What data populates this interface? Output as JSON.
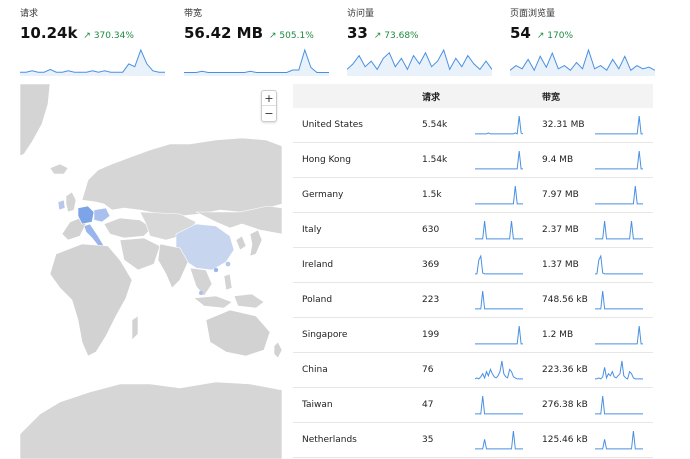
{
  "accent": "#4a90e2",
  "stats": [
    {
      "label": "请求",
      "value": "10.24k",
      "change": "↗ 370.34%",
      "spark": [
        2,
        2,
        3,
        2,
        2,
        4,
        2,
        2,
        3,
        2,
        2,
        2,
        3,
        2,
        3,
        2,
        2,
        2,
        8,
        6,
        18,
        8,
        3,
        2,
        2
      ]
    },
    {
      "label": "带宽",
      "value": "56.42 MB",
      "change": "↗ 505.1%",
      "spark": [
        2,
        2,
        2,
        3,
        2,
        2,
        2,
        2,
        2,
        2,
        2,
        3,
        2,
        2,
        2,
        2,
        2,
        2,
        4,
        4,
        20,
        6,
        2,
        2,
        2
      ]
    },
    {
      "label": "访问量",
      "value": "33",
      "change": "↗ 73.68%",
      "spark": [
        4,
        8,
        14,
        6,
        10,
        4,
        12,
        16,
        6,
        12,
        4,
        14,
        8,
        16,
        6,
        10,
        18,
        4,
        12,
        6,
        14,
        8,
        4,
        10,
        4
      ]
    },
    {
      "label": "页面浏览量",
      "value": "54",
      "change": "↗ 170%",
      "spark": [
        3,
        6,
        4,
        10,
        3,
        12,
        5,
        14,
        4,
        6,
        3,
        8,
        4,
        16,
        4,
        6,
        3,
        10,
        4,
        12,
        3,
        6,
        4,
        5,
        3
      ]
    }
  ],
  "map_controls": {
    "zoom_in": "+",
    "zoom_out": "−"
  },
  "table": {
    "col_requests": "请求",
    "col_bandwidth": "带宽",
    "rows": [
      {
        "country": "United States",
        "requests": "5.54k",
        "bandwidth": "32.31 MB",
        "req_spark": [
          1,
          1,
          1,
          1,
          1,
          1,
          1,
          2,
          1,
          1,
          1,
          1,
          1,
          1,
          1,
          1,
          1,
          1,
          1,
          1,
          1,
          2,
          1,
          18,
          2,
          1
        ],
        "bw_spark": [
          1,
          1,
          1,
          1,
          1,
          1,
          1,
          1,
          1,
          1,
          1,
          1,
          1,
          1,
          1,
          1,
          1,
          1,
          1,
          1,
          1,
          1,
          1,
          18,
          1,
          1
        ]
      },
      {
        "country": "Hong Kong",
        "requests": "1.54k",
        "bandwidth": "9.4 MB",
        "req_spark": [
          1,
          1,
          1,
          1,
          1,
          1,
          1,
          1,
          1,
          1,
          1,
          1,
          1,
          1,
          1,
          1,
          1,
          1,
          1,
          1,
          1,
          1,
          1,
          18,
          1,
          1
        ],
        "bw_spark": [
          1,
          1,
          1,
          1,
          1,
          1,
          1,
          1,
          1,
          1,
          1,
          1,
          1,
          1,
          1,
          1,
          1,
          1,
          1,
          1,
          1,
          1,
          1,
          18,
          1,
          1
        ]
      },
      {
        "country": "Germany",
        "requests": "1.5k",
        "bandwidth": "7.97 MB",
        "req_spark": [
          1,
          1,
          1,
          1,
          1,
          1,
          1,
          1,
          1,
          1,
          1,
          1,
          1,
          1,
          1,
          1,
          1,
          1,
          1,
          1,
          1,
          18,
          1,
          1,
          1,
          1
        ],
        "bw_spark": [
          1,
          1,
          1,
          1,
          1,
          1,
          1,
          1,
          1,
          1,
          1,
          1,
          1,
          1,
          1,
          1,
          1,
          1,
          1,
          1,
          1,
          18,
          1,
          1,
          1,
          1
        ]
      },
      {
        "country": "Italy",
        "requests": "630",
        "bandwidth": "2.37 MB",
        "req_spark": [
          1,
          1,
          1,
          1,
          1,
          18,
          1,
          1,
          1,
          1,
          1,
          1,
          1,
          1,
          1,
          1,
          1,
          1,
          1,
          18,
          1,
          1,
          1,
          1,
          1,
          1
        ],
        "bw_spark": [
          1,
          1,
          1,
          1,
          1,
          18,
          1,
          1,
          1,
          1,
          1,
          1,
          1,
          1,
          1,
          1,
          1,
          1,
          1,
          18,
          1,
          1,
          1,
          1,
          1,
          1
        ]
      },
      {
        "country": "Ireland",
        "requests": "369",
        "bandwidth": "1.37 MB",
        "req_spark": [
          1,
          1,
          14,
          18,
          2,
          1,
          1,
          1,
          1,
          1,
          1,
          1,
          1,
          1,
          1,
          1,
          1,
          1,
          1,
          1,
          1,
          1,
          1,
          1,
          1,
          1
        ],
        "bw_spark": [
          1,
          1,
          14,
          18,
          2,
          1,
          1,
          1,
          1,
          1,
          1,
          1,
          1,
          1,
          1,
          1,
          1,
          1,
          1,
          1,
          1,
          1,
          1,
          1,
          1,
          1
        ]
      },
      {
        "country": "Poland",
        "requests": "223",
        "bandwidth": "748.56 kB",
        "req_spark": [
          1,
          1,
          1,
          1,
          18,
          1,
          1,
          1,
          1,
          1,
          1,
          1,
          1,
          1,
          1,
          1,
          1,
          1,
          1,
          1,
          1,
          1,
          1,
          1,
          1,
          1
        ],
        "bw_spark": [
          1,
          1,
          1,
          1,
          18,
          1,
          1,
          1,
          1,
          1,
          1,
          1,
          1,
          1,
          1,
          1,
          1,
          1,
          1,
          1,
          1,
          1,
          1,
          1,
          1,
          1
        ]
      },
      {
        "country": "Singapore",
        "requests": "199",
        "bandwidth": "1.2 MB",
        "req_spark": [
          1,
          1,
          1,
          1,
          1,
          1,
          1,
          1,
          1,
          1,
          1,
          1,
          1,
          1,
          1,
          1,
          1,
          1,
          1,
          1,
          1,
          1,
          1,
          18,
          1,
          1
        ],
        "bw_spark": [
          1,
          1,
          1,
          1,
          1,
          1,
          1,
          1,
          1,
          1,
          1,
          1,
          1,
          1,
          1,
          1,
          1,
          1,
          1,
          1,
          1,
          1,
          1,
          18,
          1,
          1
        ]
      },
      {
        "country": "China",
        "requests": "76",
        "bandwidth": "223.36 kB",
        "req_spark": [
          1,
          2,
          1,
          3,
          6,
          2,
          8,
          4,
          10,
          6,
          3,
          2,
          4,
          8,
          18,
          6,
          3,
          2,
          10,
          8,
          3,
          2,
          1,
          1,
          1,
          1
        ],
        "bw_spark": [
          1,
          1,
          2,
          1,
          3,
          12,
          2,
          6,
          4,
          8,
          3,
          2,
          4,
          6,
          18,
          4,
          2,
          1,
          8,
          6,
          2,
          1,
          1,
          1,
          1,
          1
        ]
      },
      {
        "country": "Taiwan",
        "requests": "47",
        "bandwidth": "276.38 kB",
        "req_spark": [
          1,
          1,
          1,
          1,
          18,
          1,
          1,
          1,
          1,
          1,
          1,
          1,
          1,
          1,
          1,
          1,
          1,
          1,
          1,
          1,
          1,
          1,
          1,
          1,
          1,
          1
        ],
        "bw_spark": [
          1,
          1,
          1,
          1,
          18,
          1,
          1,
          1,
          1,
          1,
          1,
          1,
          1,
          1,
          1,
          1,
          1,
          1,
          1,
          1,
          1,
          1,
          1,
          1,
          1,
          1
        ]
      },
      {
        "country": "Netherlands",
        "requests": "35",
        "bandwidth": "125.46 kB",
        "req_spark": [
          1,
          1,
          1,
          1,
          1,
          10,
          1,
          1,
          1,
          1,
          1,
          1,
          1,
          1,
          1,
          1,
          1,
          1,
          1,
          1,
          18,
          1,
          1,
          1,
          1,
          1
        ],
        "bw_spark": [
          1,
          1,
          1,
          1,
          1,
          10,
          1,
          1,
          1,
          1,
          1,
          1,
          1,
          1,
          1,
          1,
          1,
          1,
          1,
          1,
          18,
          1,
          1,
          1,
          1,
          1
        ]
      }
    ]
  }
}
